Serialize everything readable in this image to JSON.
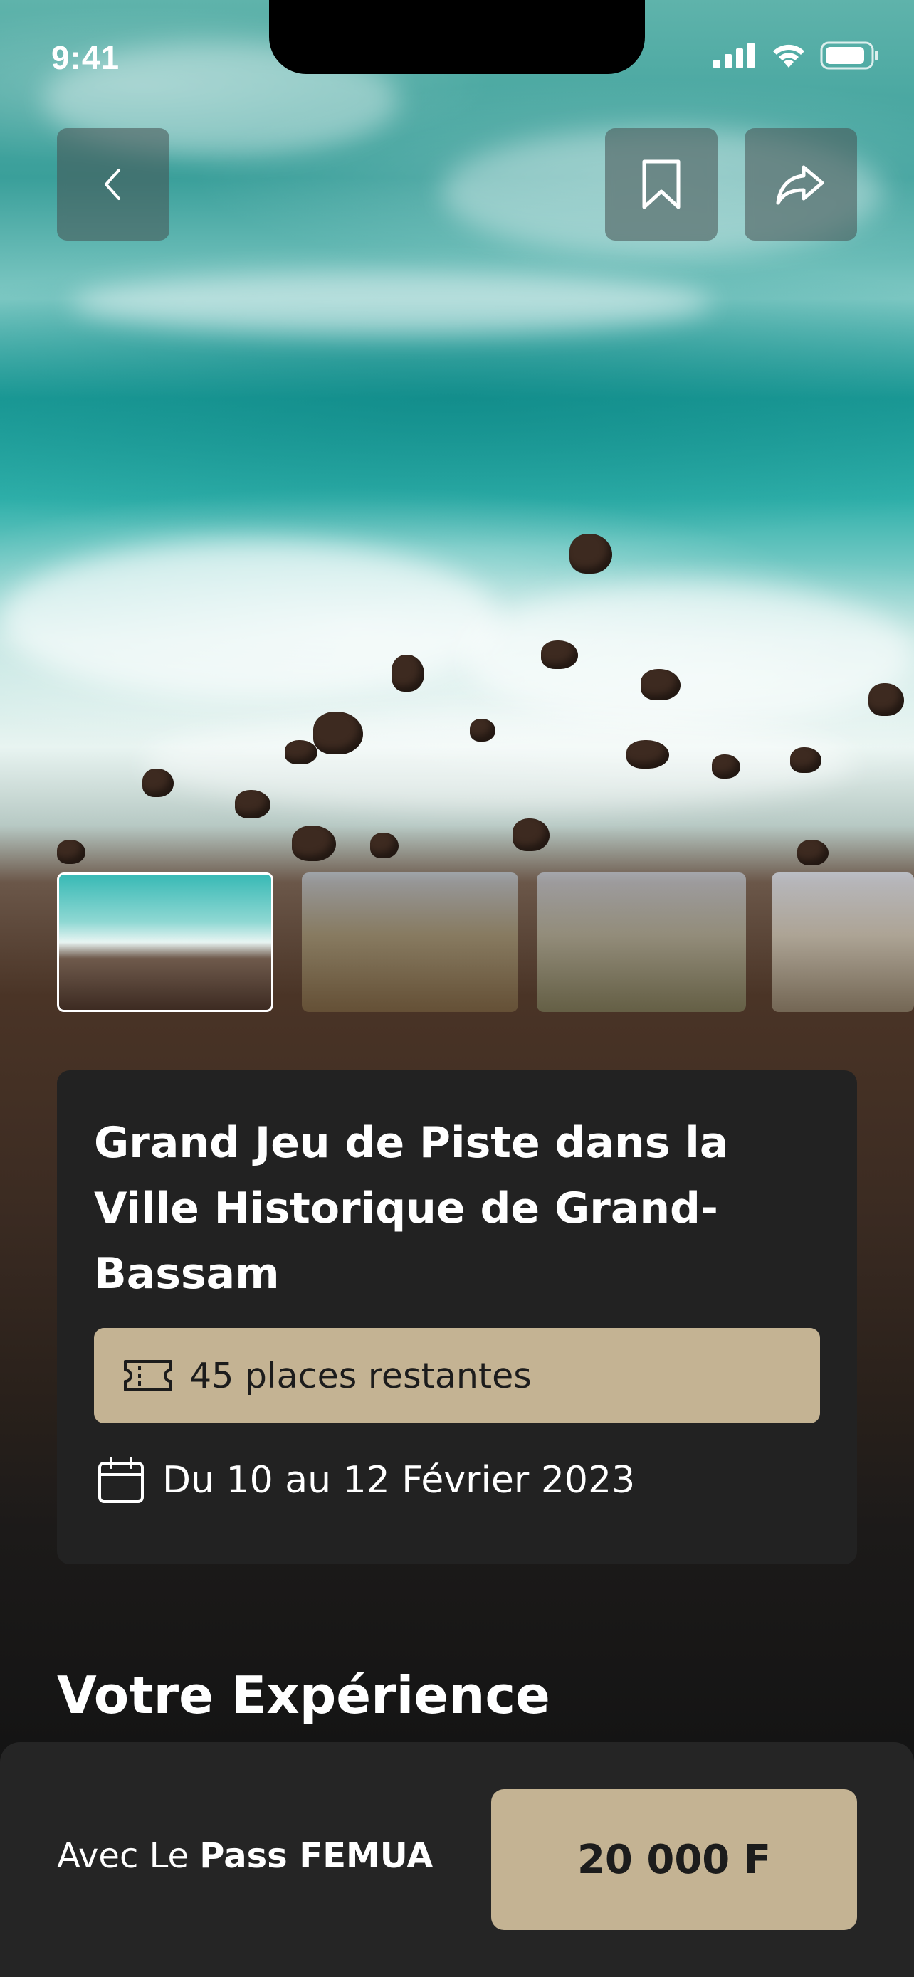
{
  "status_bar": {
    "time": "9:41"
  },
  "event": {
    "title": "Grand Jeu de Piste dans la Ville Historique de Grand-Bassam",
    "places": "45 places restantes",
    "dates": "Du 10 au 12 Février 2023"
  },
  "gallery": {
    "thumbnail_count": 4,
    "selected_index": 0
  },
  "section": {
    "heading": "Votre Expérience"
  },
  "purchase": {
    "prefix": "Avec Le ",
    "pass_name": "Pass FEMUA",
    "price": "20 000 F"
  },
  "colors": {
    "accent": "#c4b393",
    "card": "#222222",
    "bottom_bar": "#252525"
  },
  "icons": {
    "back": "chevron-left-icon",
    "bookmark": "bookmark-icon",
    "share": "share-icon",
    "ticket": "ticket-icon",
    "calendar": "calendar-icon"
  }
}
